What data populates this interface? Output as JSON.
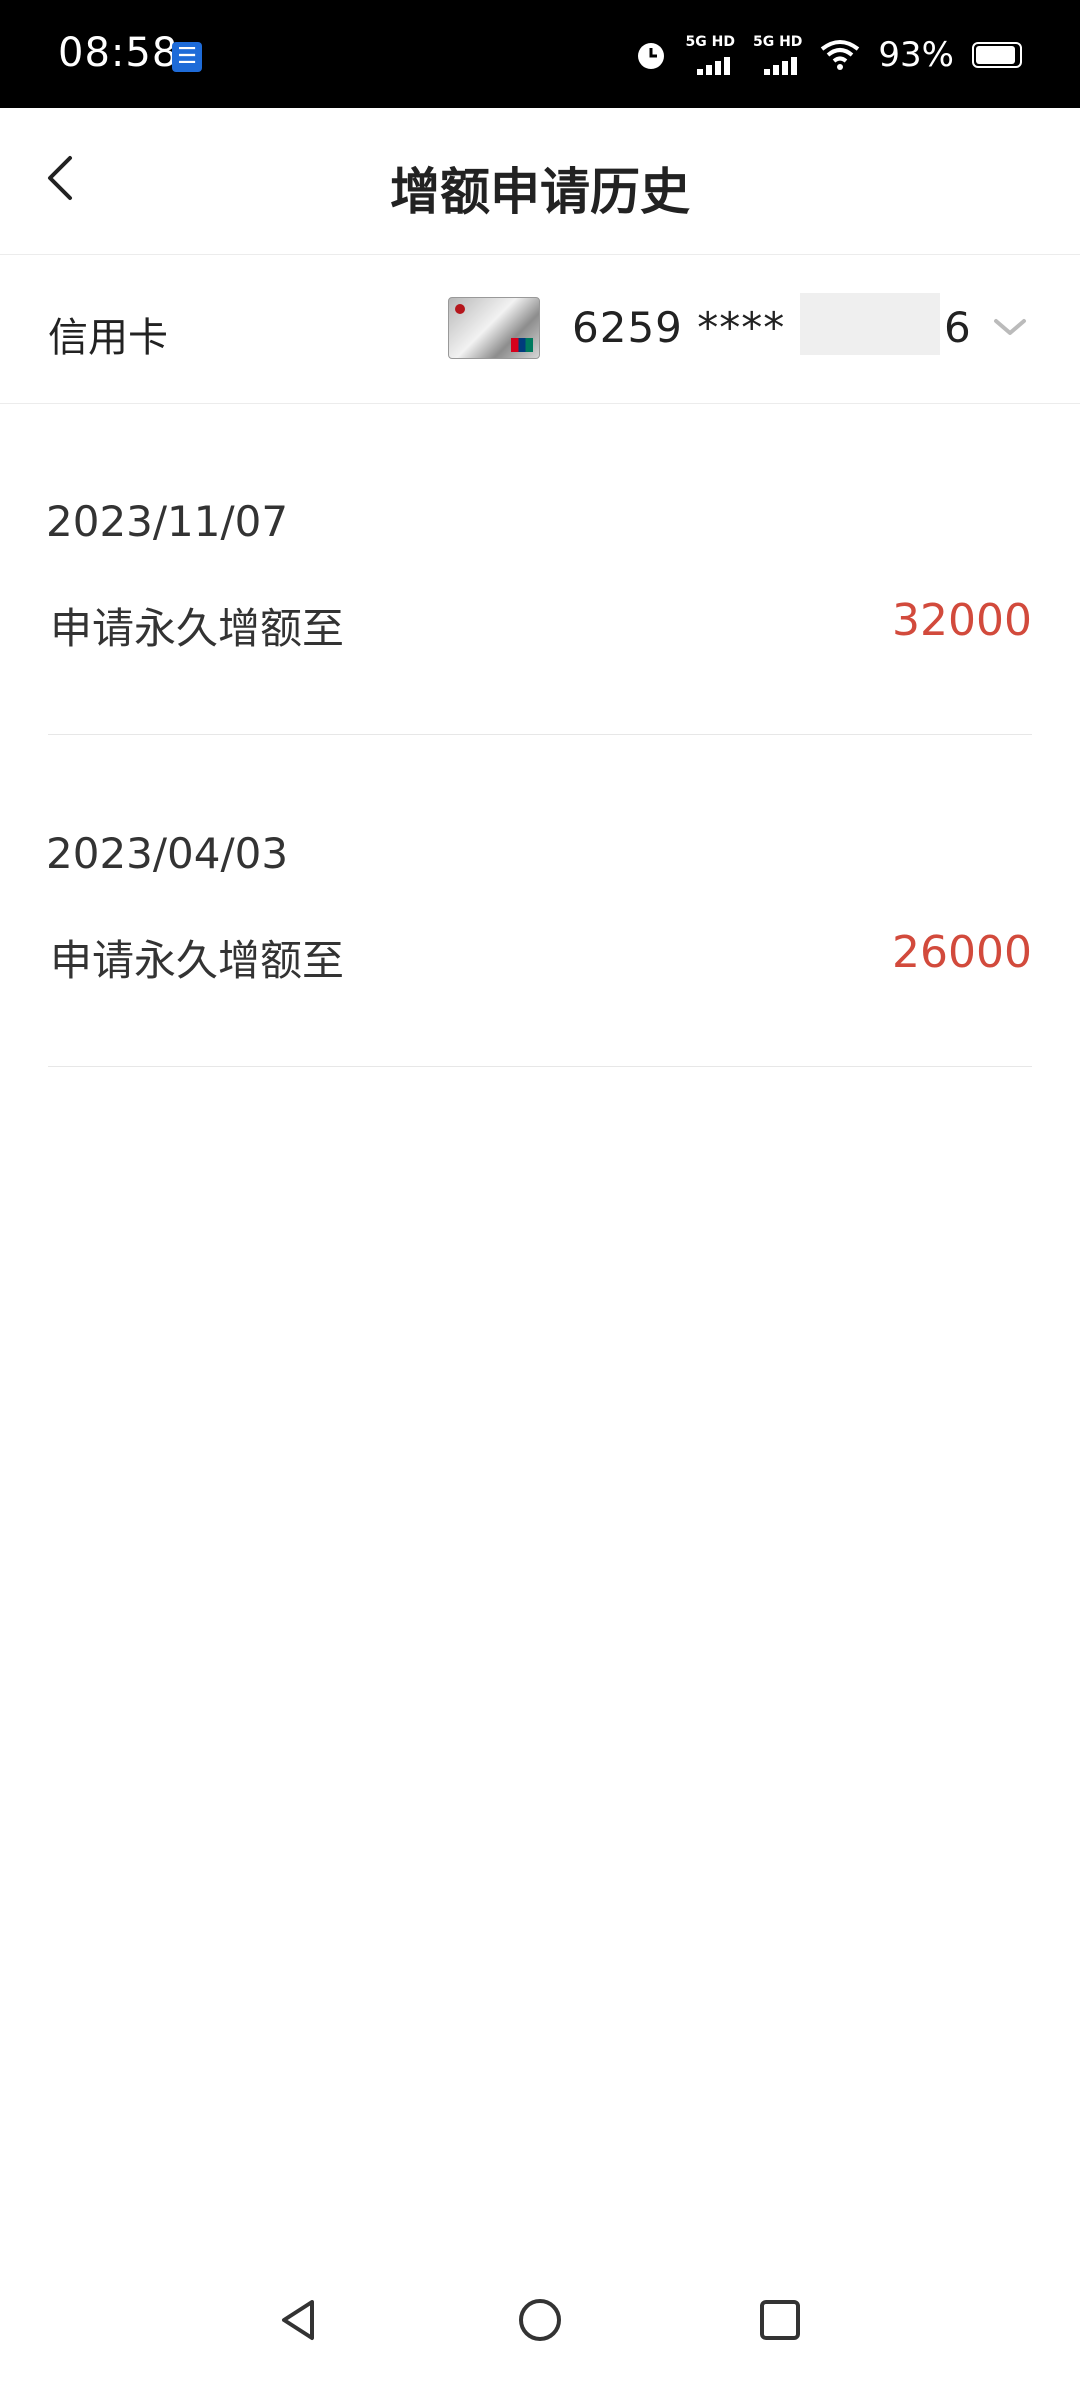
{
  "status_bar": {
    "time": "08:58",
    "net1": "5G HD",
    "net2": "5G HD",
    "battery_percent": "93%",
    "battery_level": 0.93,
    "icons": [
      "alarm-icon",
      "signal-icon",
      "signal-icon",
      "wifi-icon",
      "battery-icon"
    ]
  },
  "header": {
    "title": "增额申请历史"
  },
  "card_selector": {
    "label": "信用卡",
    "card_number": "6259 **** **",
    "card_number_tail": "6"
  },
  "records": [
    {
      "date": "2023/11/07",
      "description": "申请永久增额至",
      "amount": "32000"
    },
    {
      "date": "2023/04/03",
      "description": "申请永久增额至",
      "amount": "26000"
    }
  ],
  "colors": {
    "amount": "#d24a3c",
    "status_bar_bg": "#000000"
  }
}
